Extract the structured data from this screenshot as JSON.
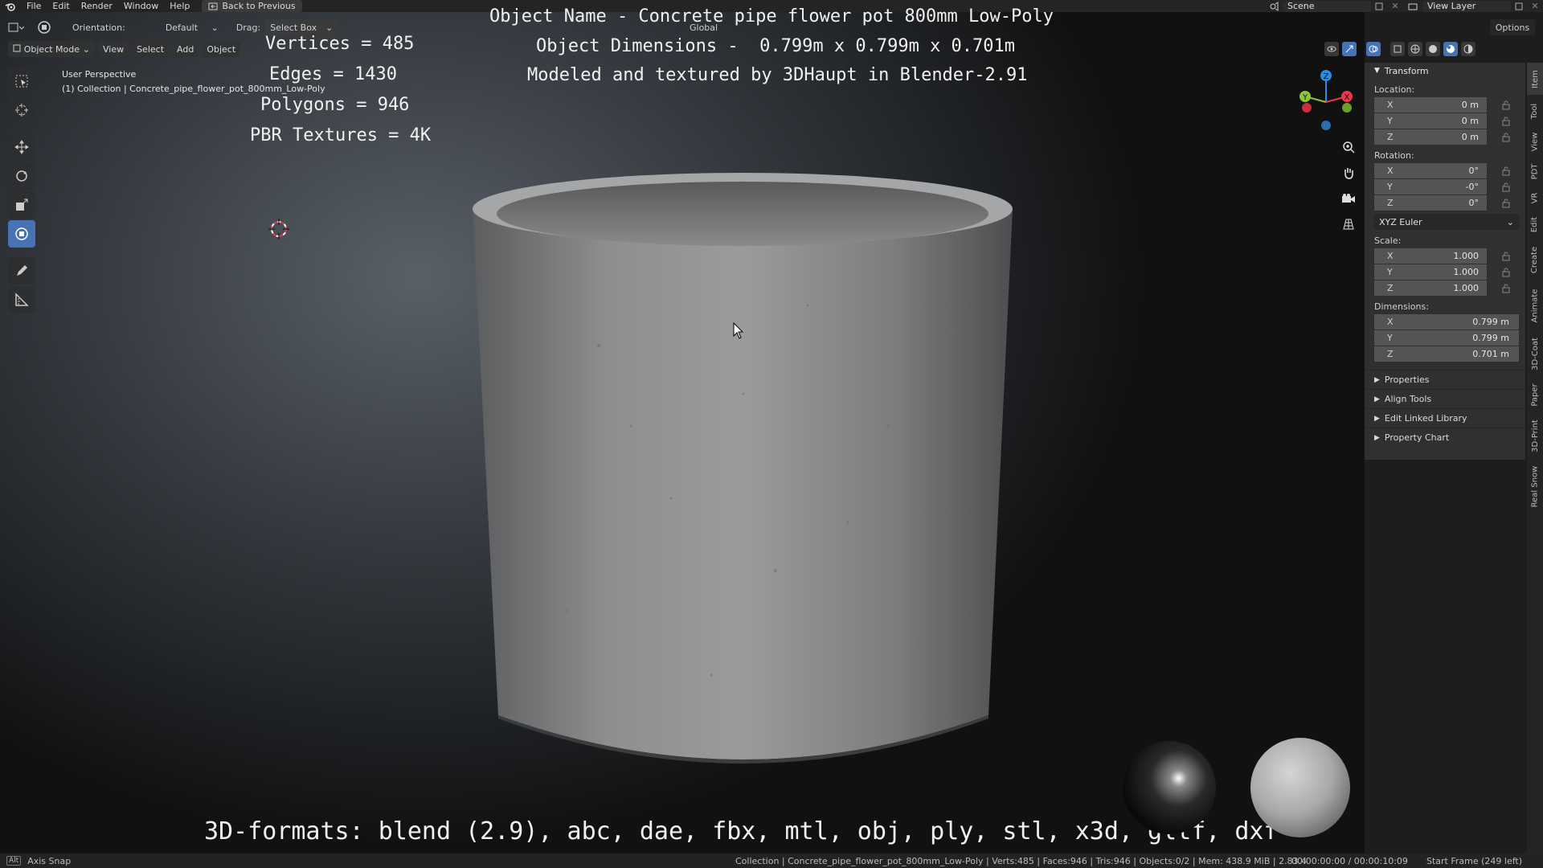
{
  "menubar": {
    "items": [
      "File",
      "Edit",
      "Render",
      "Window",
      "Help"
    ],
    "back_label": "Back to Previous",
    "scene": "Scene",
    "view_layer": "View Layer"
  },
  "header1": {
    "orientation_label": "Orientation:",
    "orientation_value": "Default",
    "drag_label": "Drag:",
    "drag_value": "Select Box",
    "transform_space": "Global",
    "options": "Options"
  },
  "header2": {
    "mode": "Object Mode",
    "menus": [
      "View",
      "Select",
      "Add",
      "Object"
    ]
  },
  "viewport": {
    "view_name": "User Perspective",
    "collection_line": "(1) Collection | Concrete_pipe_flower_pot_800mm_Low-Poly"
  },
  "overlay": {
    "object_name": "Object Name - Concrete pipe flower pot 800mm Low-Poly",
    "dimensions": "Object Dimensions -  0.799m x 0.799m x 0.701m",
    "credit": "Modeled and textured by 3DHaupt in Blender-2.91",
    "vertices": "Vertices = 485",
    "edges": "Edges = 1430",
    "polygons": "Polygons = 946",
    "textures": "PBR Textures = 4K",
    "formats": "3D-formats: blend (2.9), abc, dae, fbx, mtl, obj, ply, stl, x3d, gltf, dxf"
  },
  "npanel": {
    "title": "Transform",
    "location_label": "Location:",
    "location": [
      {
        "axis": "X",
        "value": "0 m"
      },
      {
        "axis": "Y",
        "value": "0 m"
      },
      {
        "axis": "Z",
        "value": "0 m"
      }
    ],
    "rotation_label": "Rotation:",
    "rotation": [
      {
        "axis": "X",
        "value": "0°"
      },
      {
        "axis": "Y",
        "value": "-0°"
      },
      {
        "axis": "Z",
        "value": "0°"
      }
    ],
    "rotation_mode": "XYZ Euler",
    "scale_label": "Scale:",
    "scale": [
      {
        "axis": "X",
        "value": "1.000"
      },
      {
        "axis": "Y",
        "value": "1.000"
      },
      {
        "axis": "Z",
        "value": "1.000"
      }
    ],
    "dimensions_label": "Dimensions:",
    "dimensions": [
      {
        "axis": "X",
        "value": "0.799 m"
      },
      {
        "axis": "Y",
        "value": "0.799 m"
      },
      {
        "axis": "Z",
        "value": "0.701 m"
      }
    ],
    "sections": [
      "Properties",
      "Align Tools",
      "Edit Linked Library",
      "Property Chart"
    ]
  },
  "vtabs": [
    "Item",
    "Tool",
    "View",
    "PDT",
    "VR",
    "Edit",
    "Create",
    "Animate",
    "3D-Coat",
    "Paper",
    "3D-Print",
    "Real Snow"
  ],
  "gizmo": {
    "x": "X",
    "y": "Y",
    "z": "Z",
    "colors": {
      "x": "#e8394b",
      "y": "#8bc63f",
      "z": "#2f8ae0"
    }
  },
  "statusbar": {
    "key": "Alt",
    "hint": "Axis Snap",
    "info": "Collection | Concrete_pipe_flower_pot_800mm_Low-Poly | Verts:485 | Faces:946 | Tris:946 | Objects:0/2 | Mem: 438.9 MiB | 2.83.4",
    "time": "00:00:00:00 / 00:00:10:09",
    "frame": "Start Frame (249 left)"
  },
  "colors": {
    "active_tool": "#4772b3",
    "panel_bg": "#303030",
    "field_bg": "#545454"
  }
}
